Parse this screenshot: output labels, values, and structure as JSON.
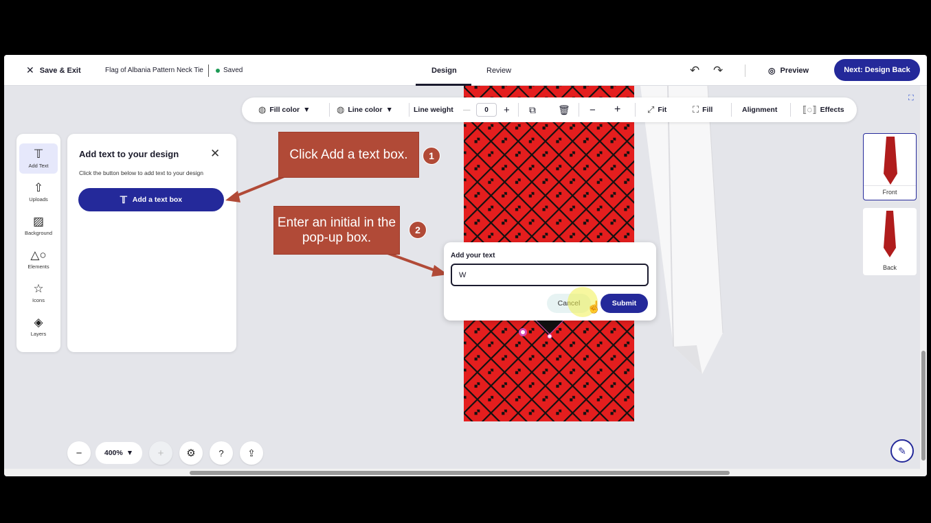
{
  "topbar": {
    "save_exit": "Save & Exit",
    "doc_title": "Flag of Albania Pattern Neck Tie",
    "saved": "Saved",
    "tabs": [
      {
        "label": "Design",
        "active": true
      },
      {
        "label": "Review",
        "active": false
      }
    ],
    "preview": "Preview",
    "next": "Next: Design Back"
  },
  "toolbar": {
    "fill_color": "Fill color",
    "line_color": "Line color",
    "line_weight": "Line weight",
    "line_weight_value": "0",
    "fit": "Fit",
    "fill": "Fill",
    "alignment": "Alignment",
    "effects": "Effects"
  },
  "rail": {
    "items": [
      {
        "label": "Add Text",
        "icon": "text-icon",
        "active": true
      },
      {
        "label": "Uploads",
        "icon": "upload-icon"
      },
      {
        "label": "Background",
        "icon": "background-icon"
      },
      {
        "label": "Elements",
        "icon": "elements-icon"
      },
      {
        "label": "Icons",
        "icon": "star-icon"
      },
      {
        "label": "Layers",
        "icon": "layers-icon"
      }
    ]
  },
  "panel": {
    "title": "Add text to your design",
    "subtitle": "Click the button below to add text to your design",
    "button": "Add a text box"
  },
  "callouts": {
    "step1_text": "Click Add a text box.",
    "step1_num": "1",
    "step2_text": "Enter an initial in the pop-up box.",
    "step2_num": "2"
  },
  "dialog": {
    "title": "Add your text",
    "input_value": "W",
    "cancel": "Cancel",
    "submit": "Submit"
  },
  "views": {
    "front": "Front",
    "back": "Back"
  },
  "zoom": {
    "level": "400%"
  },
  "colors": {
    "accent": "#24299a",
    "callout": "#b14a37",
    "tie_red": "#e41e1e",
    "saved_dot": "#1d9a55"
  }
}
